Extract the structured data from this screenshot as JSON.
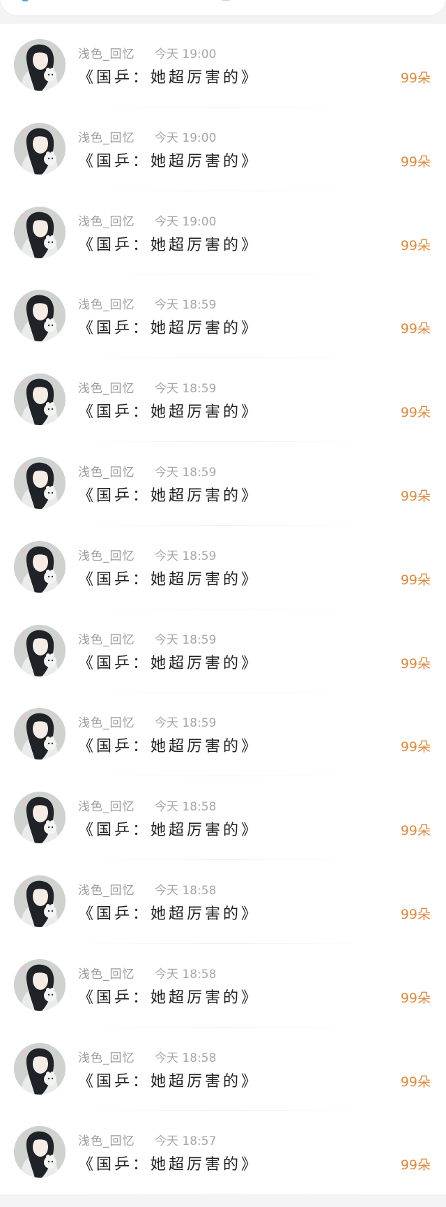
{
  "colors": {
    "accent": "#3ea7e8",
    "gift_amount": "#de8b3e",
    "title_text": "#222222",
    "meta_text": "#a8a8a8"
  },
  "messages": [
    {
      "sender": "浅色_回忆",
      "time": "今天 19:00",
      "title": "《国乒：她超厉害的》",
      "amount": "99朵"
    },
    {
      "sender": "浅色_回忆",
      "time": "今天 19:00",
      "title": "《国乒：她超厉害的》",
      "amount": "99朵"
    },
    {
      "sender": "浅色_回忆",
      "time": "今天 19:00",
      "title": "《国乒：她超厉害的》",
      "amount": "99朵"
    },
    {
      "sender": "浅色_回忆",
      "time": "今天 18:59",
      "title": "《国乒：她超厉害的》",
      "amount": "99朵"
    },
    {
      "sender": "浅色_回忆",
      "time": "今天 18:59",
      "title": "《国乒：她超厉害的》",
      "amount": "99朵"
    },
    {
      "sender": "浅色_回忆",
      "time": "今天 18:59",
      "title": "《国乒：她超厉害的》",
      "amount": "99朵"
    },
    {
      "sender": "浅色_回忆",
      "time": "今天 18:59",
      "title": "《国乒：她超厉害的》",
      "amount": "99朵"
    },
    {
      "sender": "浅色_回忆",
      "time": "今天 18:59",
      "title": "《国乒：她超厉害的》",
      "amount": "99朵"
    },
    {
      "sender": "浅色_回忆",
      "time": "今天 18:59",
      "title": "《国乒：她超厉害的》",
      "amount": "99朵"
    },
    {
      "sender": "浅色_回忆",
      "time": "今天 18:58",
      "title": "《国乒：她超厉害的》",
      "amount": "99朵"
    },
    {
      "sender": "浅色_回忆",
      "time": "今天 18:58",
      "title": "《国乒：她超厉害的》",
      "amount": "99朵"
    },
    {
      "sender": "浅色_回忆",
      "time": "今天 18:58",
      "title": "《国乒：她超厉害的》",
      "amount": "99朵"
    },
    {
      "sender": "浅色_回忆",
      "time": "今天 18:58",
      "title": "《国乒：她超厉害的》",
      "amount": "99朵"
    },
    {
      "sender": "浅色_回忆",
      "time": "今天 18:57",
      "title": "《国乒：她超厉害的》",
      "amount": "99朵"
    }
  ]
}
